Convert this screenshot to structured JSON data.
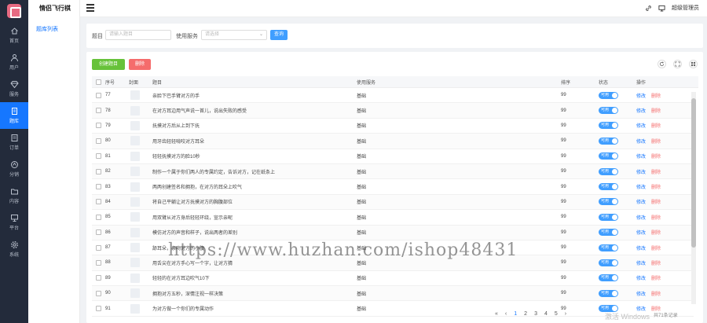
{
  "app": {
    "title": "情侣飞行棋"
  },
  "nav": {
    "items": [
      {
        "label": "首页",
        "icon": "home-icon",
        "active": false
      },
      {
        "label": "用户",
        "icon": "user-icon",
        "active": false
      },
      {
        "label": "服务",
        "icon": "diamond-icon",
        "active": false
      },
      {
        "label": "题库",
        "icon": "book-icon",
        "active": true
      },
      {
        "label": "订单",
        "icon": "order-icon",
        "active": false
      },
      {
        "label": "分销",
        "icon": "share-icon",
        "active": false
      },
      {
        "label": "内容",
        "icon": "folder-icon",
        "active": false
      },
      {
        "label": "平台",
        "icon": "monitor-icon",
        "active": false
      },
      {
        "label": "系统",
        "icon": "gear-icon",
        "active": false
      }
    ]
  },
  "submenu": {
    "item": "题库列表"
  },
  "header": {
    "user": "超级管理员"
  },
  "search": {
    "title_label": "题目",
    "title_placeholder": "请输入题目",
    "service_label": "使用服务",
    "service_placeholder": "请选择",
    "submit": "查询"
  },
  "toolbar": {
    "add": "创建题目",
    "delete": "删除"
  },
  "table": {
    "headers": {
      "id": "序号",
      "cover": "封面",
      "title": "题目",
      "service": "使用服务",
      "sort": "排序",
      "status": "状态",
      "ops": "操作"
    },
    "rows": [
      {
        "id": "77",
        "title": "亲脸下巴手臂对方的手",
        "service": "基础",
        "sort": "99",
        "status": "可用"
      },
      {
        "id": "78",
        "title": "在对方耳边用气声说一首儿，说出失败的感受",
        "service": "基础",
        "sort": "99",
        "status": "可用"
      },
      {
        "id": "79",
        "title": "抚摸对方后从上到下抚",
        "service": "基础",
        "sort": "99",
        "status": "可用"
      },
      {
        "id": "80",
        "title": "用牙齿轻轻啃咬对方耳朵",
        "service": "基础",
        "sort": "99",
        "status": "可用"
      },
      {
        "id": "81",
        "title": "轻轻抚摸对方的脸10秒",
        "service": "基础",
        "sort": "99",
        "status": "可用"
      },
      {
        "id": "82",
        "title": "制作一个属于你们两人的专属约定，告诉对方，记在纸条上",
        "service": "基础",
        "sort": "99",
        "status": "可用"
      },
      {
        "id": "83",
        "title": "两两创建签名和拥抱，在对方的耳朵上吹气",
        "service": "基础",
        "sort": "99",
        "status": "可用"
      },
      {
        "id": "84",
        "title": "将自己平躺让对方抚摸对方的胸腹部位",
        "service": "基础",
        "sort": "99",
        "status": "可用"
      },
      {
        "id": "85",
        "title": "用双臂从对方身后轻轻环绕，宣示亲昵",
        "service": "基础",
        "sort": "99",
        "status": "可用"
      },
      {
        "id": "86",
        "title": "模仿对方的声音和样子，说出两者的差别",
        "service": "基础",
        "sort": "99",
        "status": "可用"
      },
      {
        "id": "87",
        "title": "舔耳朵，亲吻对方的小腹",
        "service": "基础",
        "sort": "99",
        "status": "可用"
      },
      {
        "id": "88",
        "title": "用舌尖在对方手心写一个字，让对方猜",
        "service": "基础",
        "sort": "99",
        "status": "可用"
      },
      {
        "id": "89",
        "title": "轻轻的在对方耳边吹气10下",
        "service": "基础",
        "sort": "99",
        "status": "可用"
      },
      {
        "id": "90",
        "title": "拥抱对方五秒，深情注视一样决策",
        "service": "基础",
        "sort": "99",
        "status": "可用"
      },
      {
        "id": "91",
        "title": "为对方做一个你们的专属动作",
        "service": "基础",
        "sort": "99",
        "status": "可用"
      }
    ],
    "op_edit": "修改",
    "op_delete": "删除"
  },
  "pager": {
    "pages": [
      "1",
      "2",
      "3",
      "4",
      "5"
    ],
    "current": "1",
    "info": "共71条记录"
  },
  "watermark": "https://www.huzhan.com/ishop48431",
  "windows_mark": "激活 Windows"
}
